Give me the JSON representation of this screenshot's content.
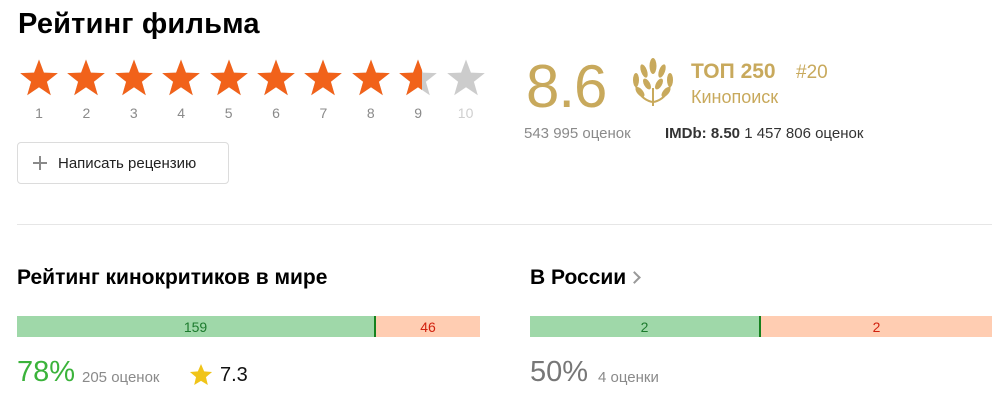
{
  "page": {
    "title": "Рейтинг фильма"
  },
  "user_rating": {
    "stars": [
      "1",
      "2",
      "3",
      "4",
      "5",
      "6",
      "7",
      "8",
      "9",
      "10"
    ],
    "colors": {
      "filled": "#f1621a",
      "empty": "#cccccc"
    },
    "fill_value": 8.6
  },
  "review_button": {
    "label": "Написать рецензию",
    "icon": "plus-icon"
  },
  "rating": {
    "value": "8.6",
    "top_label": "ТОП 250",
    "top_rank": "#20",
    "source": "Кинопоиск",
    "votes": "543 995 оценок",
    "imdb_label": "IMDb: 8.50",
    "imdb_votes": "1 457 806 оценок",
    "accent_color": "#c8a95c"
  },
  "critics_world": {
    "title": "Рейтинг кинокритиков в мире",
    "positive": "159",
    "negative": "46",
    "percent": "78%",
    "count": "205 оценок",
    "average": "7.3",
    "percent_color": "#3bb33b"
  },
  "critics_russia": {
    "title": "В России",
    "positive": "2",
    "negative": "2",
    "percent": "50%",
    "count": "4 оценки",
    "percent_color": "#777777"
  }
}
